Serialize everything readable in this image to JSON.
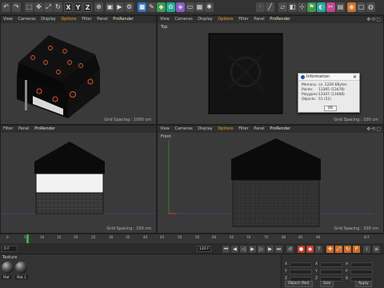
{
  "toolbar": {
    "axis_x": "X",
    "axis_y": "Y",
    "axis_z": "Z"
  },
  "viewports": {
    "top_left": {
      "menu": [
        "View",
        "Cameras",
        "Display",
        "Options",
        "Filter",
        "Panel",
        "ProRender"
      ],
      "label": "",
      "grid": "Grid Spacing : 1000 cm"
    },
    "top_right": {
      "menu": [
        "View",
        "Cameras",
        "Display",
        "Options",
        "Filter",
        "Panel",
        "ProRender"
      ],
      "label": "Top",
      "grid": "Grid Spacing : 100 cm"
    },
    "bottom_left": {
      "menu": [
        "Filter",
        "Panel",
        "ProRender"
      ],
      "label": "",
      "grid": "Grid Spacing : 100 cm"
    },
    "bottom_right": {
      "menu": [
        "View",
        "Cameras",
        "Display",
        "Options",
        "Filter",
        "Panel",
        "ProRender"
      ],
      "label": "Front",
      "grid": "Grid Spacing : 100 cm"
    }
  },
  "info_dialog": {
    "title": "Information",
    "rows": [
      {
        "label": "Memory:",
        "value": "ca. 2226 KBytes"
      },
      {
        "label": "Points:",
        "value": "13365 (13478)"
      },
      {
        "label": "Polygons:",
        "value": "13347 (13468)"
      },
      {
        "label": "Objects:",
        "value": "51 (51)"
      }
    ],
    "ok": "OK"
  },
  "timeline": {
    "ticks": [
      "0",
      "5",
      "10",
      "15",
      "20",
      "25",
      "30",
      "35",
      "40",
      "45",
      "50",
      "55",
      "60",
      "65",
      "70",
      "75",
      "80",
      "85",
      "90"
    ],
    "end_label": "0 F",
    "current_frame": "0 F",
    "max_frame": "120 F"
  },
  "material_manager": {
    "menu": "Texture",
    "materials": [
      "Mat",
      "Mat.1"
    ]
  },
  "coordinates": {
    "rows": [
      {
        "a": "X",
        "b": "X",
        "c": "H"
      },
      {
        "a": "Y",
        "b": "Y",
        "c": "P"
      },
      {
        "a": "Z",
        "b": "Z",
        "c": "B"
      }
    ],
    "mode": "Object (Rel)",
    "size": "Size",
    "apply": "Apply"
  },
  "colors": {
    "accent_orange": "#f5a623",
    "viewport_bg": "#3a3a3a",
    "playhead": "#3fae49"
  }
}
